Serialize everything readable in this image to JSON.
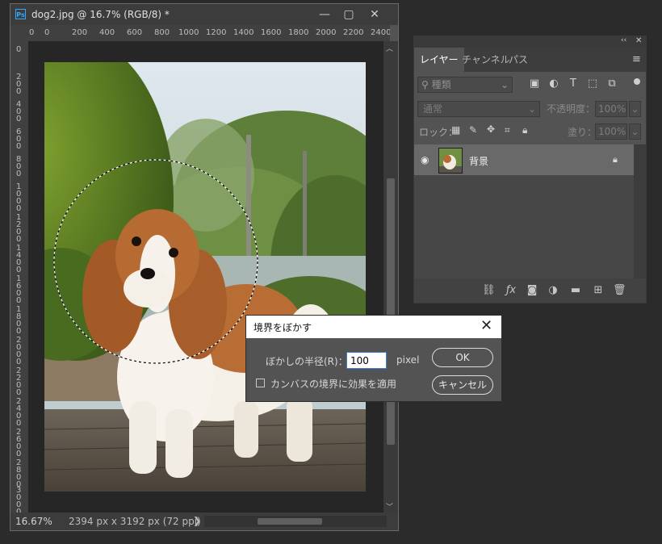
{
  "document": {
    "title": "dog2.jpg @ 16.7% (RGB/8) *",
    "app_icon_text": "Ps",
    "window_buttons": [
      "—",
      "▢",
      "✕"
    ],
    "ruler_h_labels": [
      "0",
      "0",
      "200",
      "400",
      "600",
      "800",
      "1000",
      "1200",
      "1400",
      "1600",
      "1800",
      "2000",
      "2200",
      "2400"
    ],
    "ruler_v_labels": [
      "0",
      "200",
      "400",
      "600",
      "800",
      "1000",
      "1200",
      "1400",
      "1600",
      "1800",
      "2000",
      "2200",
      "2400",
      "2600",
      "2800",
      "3000"
    ],
    "zoom": "16.67%",
    "doc_size": "2394 px x 3192 px (72 ppi)",
    "status_arrow": "❯"
  },
  "layers_panel": {
    "collapse_icon": "‹‹",
    "close_icon": "✕",
    "tabs": [
      "レイヤー",
      "チャンネル",
      "パス"
    ],
    "menu_icon": "≡",
    "filter_kind": "種類",
    "blend_mode": "通常",
    "opacity_label": "不透明度：",
    "opacity_value": "100%",
    "lock_label": "ロック：",
    "fill_label": "塗り：",
    "fill_value": "100%",
    "layer_name": "背景"
  },
  "dialog": {
    "title": "境界をぼかす",
    "radius_label": "ぼかしの半径(R)：",
    "radius_value": "100",
    "unit": "pixel",
    "ok_label": "OK",
    "cancel_label": "キャンセル",
    "apply_label": "カンバスの境界に効果を適用",
    "apply_checked": false
  },
  "colors": {
    "accent": "#31a8ff",
    "panel_bg": "#535353",
    "app_bg": "#2b2b2b"
  }
}
